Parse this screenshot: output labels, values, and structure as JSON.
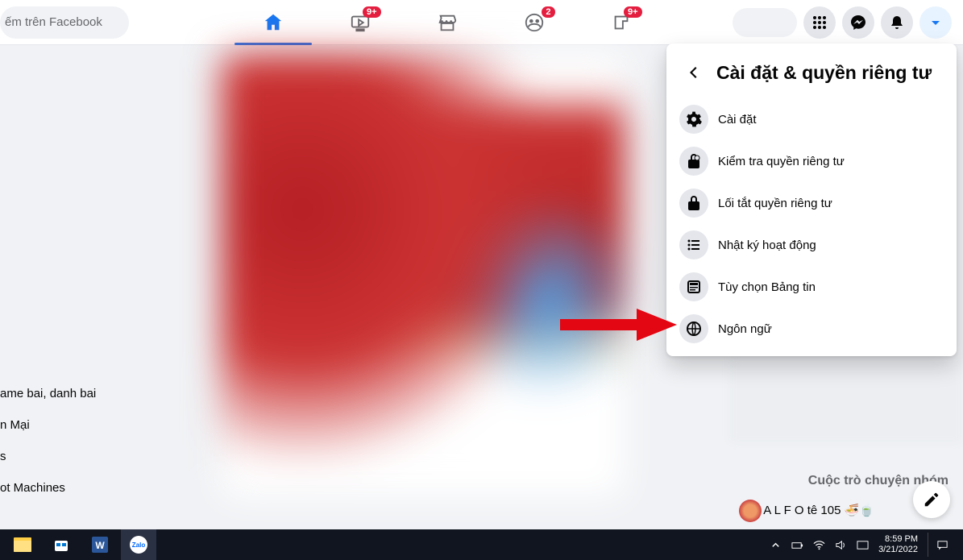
{
  "search": {
    "placeholder": "ếm trên Facebook"
  },
  "nav": {
    "badges": {
      "watch": "9+",
      "groups": "2",
      "gaming": "9+"
    }
  },
  "panel": {
    "title": "Cài đặt & quyền riêng tư",
    "items": [
      {
        "label": "Cài đặt"
      },
      {
        "label": "Kiểm tra quyền riêng tư"
      },
      {
        "label": "Lối tắt quyền riêng tư"
      },
      {
        "label": "Nhật ký hoạt động"
      },
      {
        "label": "Tùy chọn Bảng tin"
      },
      {
        "label": "Ngôn ngữ"
      }
    ]
  },
  "left_sidebar": {
    "items": [
      "ame bai, danh bai",
      "n Mại",
      "s",
      "ot Machines"
    ]
  },
  "right": {
    "group_chat_heading": "Cuộc trò chuyện nhóm",
    "contact_fragment": "A  L   F    O tê 105 🍜🍵"
  },
  "taskbar": {
    "time": "8:59 PM",
    "date": "3/21/2022"
  }
}
